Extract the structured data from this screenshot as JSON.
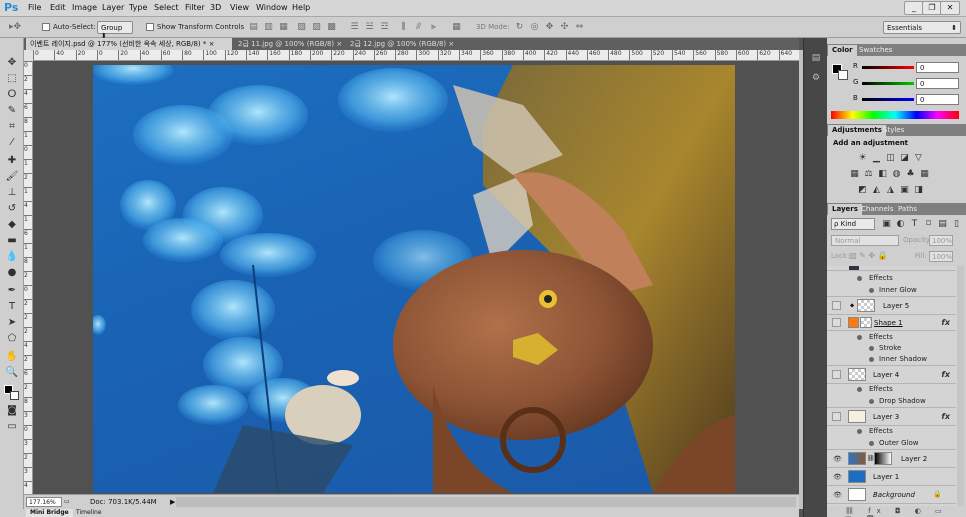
{
  "menubar": {
    "logo": "Ps",
    "items": [
      "File",
      "Edit",
      "Image",
      "Layer",
      "Type",
      "Select",
      "Filter",
      "3D",
      "View",
      "Window",
      "Help"
    ],
    "window_buttons": [
      "_",
      "❐",
      "✕"
    ]
  },
  "options": {
    "auto_select_label": "Auto-Select:",
    "auto_select_value": "Group",
    "show_transform_label": "Show Transform Controls",
    "mode_3d_label": "3D Mode:",
    "workspace": "Essentials"
  },
  "tabs": [
    {
      "label": "이벤트 레이지.psd @ 177% (선비한 옥속 세상, RGB/8) *",
      "active": true
    },
    {
      "label": "2급 11.jpg @ 100% (RGB/8)",
      "active": false
    },
    {
      "label": "2급 12.jpg @ 100% (RGB/8)",
      "active": false
    }
  ],
  "ruler_top": [
    "0",
    "40",
    "20",
    "0",
    "20",
    "40",
    "60",
    "80",
    "100",
    "120",
    "140",
    "160",
    "180",
    "200",
    "220",
    "240",
    "260",
    "280",
    "300",
    "320",
    "340",
    "360",
    "380",
    "400",
    "420",
    "440",
    "460",
    "480",
    "500",
    "520",
    "540",
    "560",
    "580",
    "600",
    "620",
    "640"
  ],
  "ruler_left": [
    "0",
    "2",
    "4",
    "6",
    "8",
    "1",
    "0",
    "1",
    "2",
    "1",
    "4",
    "1",
    "6",
    "1",
    "8",
    "2",
    "0",
    "2",
    "2",
    "2",
    "4",
    "2",
    "6",
    "2",
    "8",
    "3",
    "0",
    "3",
    "2",
    "3",
    "4"
  ],
  "status": {
    "zoom": "177.16%",
    "doc": "Doc: 703.1K/5.44M"
  },
  "bottom_tabs": [
    "Mini Bridge",
    "Timeline"
  ],
  "color_panel": {
    "tabs": [
      "Color",
      "Swatches"
    ],
    "sliders": [
      {
        "label": "R",
        "value": "0",
        "color": "#d22"
      },
      {
        "label": "G",
        "value": "0",
        "color": "#2a2"
      },
      {
        "label": "B",
        "value": "0",
        "color": "#22c"
      }
    ]
  },
  "adjustments_panel": {
    "tabs": [
      "Adjustments",
      "Styles"
    ],
    "heading": "Add an adjustment"
  },
  "layers_panel": {
    "tabs": [
      "Layers",
      "Channels",
      "Paths"
    ],
    "kind_label": "ρ Kind",
    "blend_mode": "Normal",
    "opacity_label": "Opacity:",
    "opacity_value": "100%",
    "lock_label": "Lock:",
    "fill_label": "Fill:",
    "fill_value": "100%",
    "layers": [
      {
        "name": "Effects",
        "type": "effects-header"
      },
      {
        "name": "Inner Glow",
        "type": "effect"
      },
      {
        "name": "Layer 5",
        "type": "layer",
        "fx": false
      },
      {
        "name": "Shape 1",
        "type": "layer",
        "fx": true
      },
      {
        "name": "Effects",
        "type": "effects-header"
      },
      {
        "name": "Stroke",
        "type": "effect"
      },
      {
        "name": "Inner Shadow",
        "type": "effect"
      },
      {
        "name": "Layer 4",
        "type": "layer",
        "fx": true
      },
      {
        "name": "Effects",
        "type": "effects-header"
      },
      {
        "name": "Drop Shadow",
        "type": "effect"
      },
      {
        "name": "Layer 3",
        "type": "layer",
        "fx": true
      },
      {
        "name": "Effects",
        "type": "effects-header"
      },
      {
        "name": "Outer Glow",
        "type": "effect"
      },
      {
        "name": "Layer 2",
        "type": "layer",
        "fx": false
      },
      {
        "name": "Layer 1",
        "type": "layer",
        "fx": false
      },
      {
        "name": "Background",
        "type": "layer",
        "fx": false
      }
    ],
    "fx_label": "fx"
  }
}
